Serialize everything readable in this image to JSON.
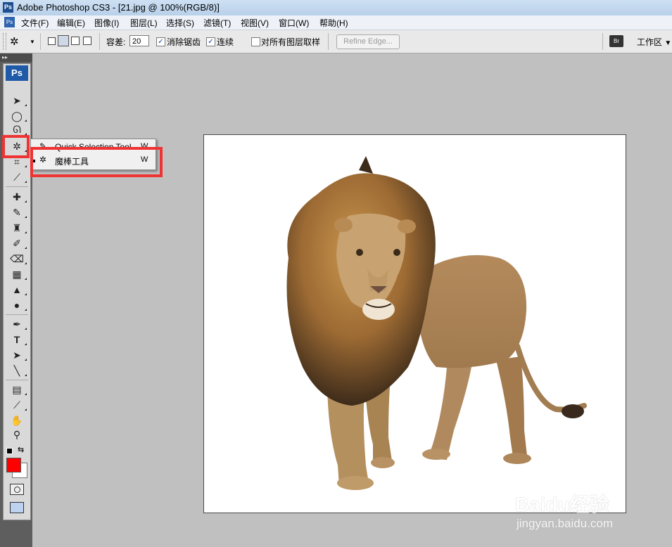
{
  "window": {
    "title": "Adobe Photoshop CS3 - [21.jpg @ 100%(RGB/8)]"
  },
  "menubar": {
    "items": [
      "文件(F)",
      "编辑(E)",
      "图像(I)",
      "图层(L)",
      "选择(S)",
      "滤镜(T)",
      "视图(V)",
      "窗口(W)",
      "帮助(H)"
    ]
  },
  "options": {
    "tolerance_label": "容差:",
    "tolerance_value": "20",
    "anti_alias_label": "消除锯齿",
    "contiguous_label": "连续",
    "sample_all_label": "对所有图层取样",
    "refine_edge_label": "Refine Edge...",
    "workspace_label": "工作区",
    "anti_alias_checked": true,
    "contiguous_checked": true,
    "sample_all_checked": false
  },
  "toolbox": {
    "badge": "Ps",
    "tools": [
      "move-tool",
      "marquee-tool",
      "lasso-tool",
      "magic-wand-tool",
      "crop-tool",
      "slice-tool",
      "healing-tool",
      "brush-tool",
      "clone-stamp-tool",
      "history-brush-tool",
      "eraser-tool",
      "gradient-tool",
      "blur-tool",
      "dodge-tool",
      "pen-tool",
      "type-tool",
      "path-selection-tool",
      "line-tool",
      "notes-tool",
      "eyedropper-tool",
      "hand-tool",
      "zoom-tool"
    ],
    "foreground_color": "#ff0000",
    "background_color": "#ffffff"
  },
  "flyout": {
    "items": [
      {
        "label": "Quick Selection Tool",
        "shortcut": "W",
        "icon": "quick-selection-icon",
        "active": false
      },
      {
        "label": "魔棒工具",
        "shortcut": "W",
        "icon": "magic-wand-icon",
        "active": true
      }
    ]
  },
  "highlight_color": "#ef3333",
  "watermark": {
    "brand": "Baidu经验",
    "url": "jingyan.baidu.com"
  }
}
